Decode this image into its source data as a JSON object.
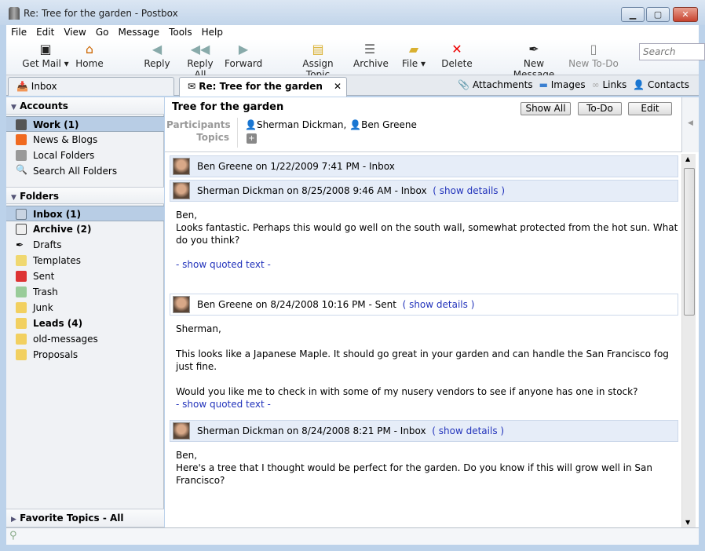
{
  "window": {
    "title": "Re: Tree for the garden - Postbox",
    "minimize": "▁",
    "maximize": "▢",
    "close": "✕"
  },
  "menu": [
    "File",
    "Edit",
    "View",
    "Go",
    "Message",
    "Tools",
    "Help"
  ],
  "toolbar": {
    "get_mail": "Get Mail",
    "home": "Home",
    "reply": "Reply",
    "reply_all": "Reply All",
    "forward": "Forward",
    "assign_topic": "Assign Topic",
    "archive": "Archive",
    "file": "File",
    "delete": "Delete",
    "new_message": "New Message",
    "new_todo": "New To-Do",
    "search_placeholder": "Search"
  },
  "tabs": [
    {
      "label": "Inbox"
    },
    {
      "label": "Re: Tree for the garden",
      "close": "✕"
    }
  ],
  "filters": [
    "Attachments",
    "Images",
    "Links",
    "Contacts"
  ],
  "sidebar": {
    "accounts_header": "Accounts",
    "accounts": [
      "Work (1)",
      "News & Blogs",
      "Local Folders",
      "Search All Folders"
    ],
    "folders_header": "Folders",
    "folders": [
      "Inbox (1)",
      "Archive (2)",
      "Drafts",
      "Templates",
      "Sent",
      "Trash",
      "Junk",
      "Leads (4)",
      "old-messages",
      "Proposals"
    ],
    "favorites": "Favorite Topics - All"
  },
  "conversation": {
    "title": "Tree for the garden",
    "buttons": {
      "show_all": "Show All",
      "todo": "To-Do",
      "edit": "Edit"
    },
    "participants_label": "Participants",
    "topics_label": "Topics",
    "participants": [
      "Sherman Dickman,",
      "Ben Greene"
    ],
    "messages": [
      {
        "header": "Ben Greene on 1/22/2009 7:41 PM  -  Inbox"
      },
      {
        "header": "Sherman Dickman on 8/25/2008 9:46 AM  -  Inbox",
        "details": "( show details )",
        "lines": [
          "Ben,",
          "Looks fantastic.  Perhaps this would go well on the south wall, somewhat protected from the hot sun.  What",
          "do you think?"
        ],
        "quoted": "- show quoted text -"
      },
      {
        "header": "Ben Greene on 8/24/2008 10:16 PM  -  Sent",
        "details": "( show details )",
        "lines": [
          "Sherman,",
          "This looks like a Japanese Maple. It should go great in your garden and can handle the San Francisco fog",
          "just fine.",
          "Would you like me to check in with some of my nusery vendors to see if anyone has one in stock?"
        ],
        "quoted": "- show quoted text -"
      },
      {
        "header": "Sherman Dickman on 8/24/2008 8:21 PM  -  Inbox",
        "details": "( show details )",
        "lines": [
          "Ben,",
          "Here's a tree that I thought would be perfect for the garden.  Do you know if this will grow well in San",
          "Francisco?"
        ]
      }
    ]
  }
}
